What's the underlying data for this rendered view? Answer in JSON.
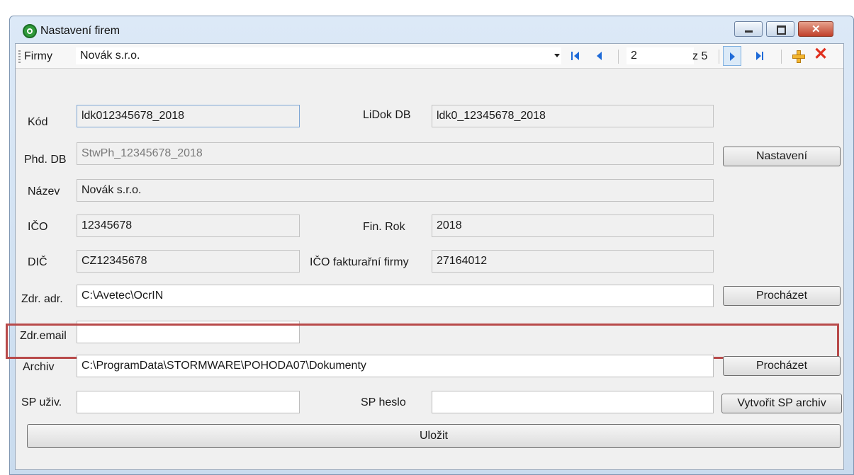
{
  "window": {
    "title": "Nastavení firem"
  },
  "toolbar": {
    "label": "Firmy",
    "company_value": "Novák s.r.o.",
    "position": "2",
    "count_text": "z 5"
  },
  "form": {
    "kod_label": "Kód",
    "kod_value": "ldk012345678_2018",
    "lidok_label": "LiDok DB",
    "lidok_value": "ldk0_12345678_2018",
    "phd_label": "Phd. DB",
    "phd_value": "StwPh_12345678_2018",
    "nastaveni_button": "Nastavení",
    "nazev_label": "Název",
    "nazev_value": "Novák s.r.o.",
    "ico_label": "IČO",
    "ico_value": "12345678",
    "finrok_label": "Fin. Rok",
    "finrok_value": "2018",
    "dic_label": "DIČ",
    "dic_value": "CZ12345678",
    "ico_fakt_label": "IČO fakturařní firmy",
    "ico_fakt_value": "27164012",
    "zdradr_label": "Zdr. adr.",
    "zdradr_value": "C:\\Avetec\\OcrIN",
    "prochazet_button": "Procházet",
    "zdremail_label": "Zdr.email",
    "zdremail_value": "",
    "archiv_label": "Archiv",
    "archiv_value": "C:\\ProgramData\\STORMWARE\\POHODA07\\Dokumenty",
    "archiv_prochazet_button": "Procházet",
    "spuziv_label": "SP uživ.",
    "spuziv_value": "",
    "spheslo_label": "SP heslo",
    "spheslo_value": "",
    "vytvorit_button": "Vytvořit SP archiv",
    "ulozit_button": "Uložit"
  },
  "colors": {
    "highlight_border": "#b84a4a",
    "nav_blue": "#1f6bd8",
    "delete_red": "#e0301e"
  },
  "icons": [
    "app-icon",
    "minimize-icon",
    "maximize-icon",
    "close-icon",
    "first-record-icon",
    "prev-record-icon",
    "next-record-icon",
    "last-record-icon",
    "add-icon",
    "delete-icon"
  ]
}
